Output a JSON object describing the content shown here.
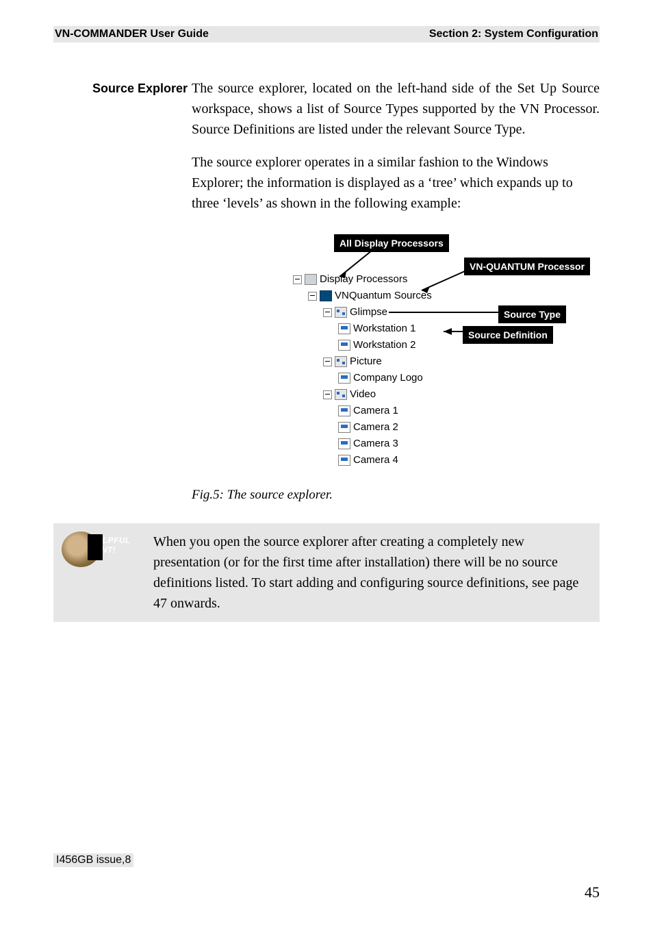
{
  "header": {
    "left": "VN-COMMANDER User Guide",
    "right": "Section 2: System Configuration"
  },
  "section": {
    "margin_heading": "Source Explorer",
    "para1": "The source explorer, located on the left-hand side of the Set Up Source workspace, shows a list of Source Types supported by the VN Processor. Source Definitions are listed under the relevant Source Type.",
    "para2": "The source explorer operates in a similar fashion to the Windows Explorer; the information is displayed as a ‘tree’ which expands up to three ‘levels’ as shown in the following example:"
  },
  "callouts": {
    "all": "All Display Processors",
    "proc": "VN-QUANTUM Processor",
    "type": "Source Type",
    "def": "Source Definition"
  },
  "tree": {
    "root": "Display Processors",
    "quantum": "VNQuantum Sources",
    "types": [
      {
        "name": "Glimpse",
        "defs": [
          "Workstation 1",
          "Workstation 2"
        ]
      },
      {
        "name": "Picture",
        "defs": [
          "Company Logo"
        ]
      },
      {
        "name": "Video",
        "defs": [
          "Camera 1",
          "Camera 2",
          "Camera 3",
          "Camera 4"
        ]
      }
    ]
  },
  "figure_caption": "Fig.5: The source explorer.",
  "hint": {
    "badge_line1": "HELPFUL",
    "badge_line2": "HINT!",
    "text": "When you open the source explorer after creating a completely new presentation (or for the first time after installation) there will be no source definitions listed. To start adding and configuring source definitions, see page 47 onwards."
  },
  "footer": {
    "issue": "I456GB issue,8",
    "page": "45"
  }
}
